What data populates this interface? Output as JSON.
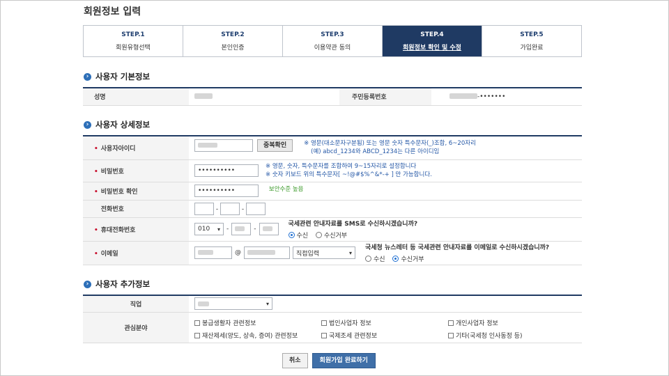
{
  "page_title": "회원정보 입력",
  "steps": [
    {
      "num": "STEP.1",
      "name": "회원유형선택"
    },
    {
      "num": "STEP.2",
      "name": "본인인증"
    },
    {
      "num": "STEP.3",
      "name": "이용약관 동의"
    },
    {
      "num": "STEP.4",
      "name": "회원정보 확인 및 수정"
    },
    {
      "num": "STEP.5",
      "name": "가입완료"
    }
  ],
  "active_step": 4,
  "basic": {
    "title": "사용자 기본정보",
    "name_label": "성명",
    "rrn_label": "주민등록번호",
    "rrn_mask": "-•••••••"
  },
  "detail": {
    "title": "사용자 상세정보",
    "id_label": "사용자아이디",
    "dup_check_button": "중복확인",
    "id_note_1": "※ 영문(대소문자구분됨) 또는 영문 숫자 특수문자(_)조합, 6~20자리",
    "id_note_2": "(예) abcd_1234와 ABCD_1234는 다른 아이디임",
    "pw_label": "비밀번호",
    "pw_value": "••••••••••",
    "pw_note_1": "※ 영문, 숫자, 특수문자를 조합하여 9~15자리로 설정합니다",
    "pw_note_2": "※ 숫자 키보드 위의 특수문자[ ~!@#$%^&*-+ ] 만 가능합니다.",
    "pw_confirm_label": "비밀번호 확인",
    "pw_confirm_value": "••••••••••",
    "pw_strength": "보안수준 높음",
    "phone_label": "전화번호",
    "dash": "-",
    "mobile_label": "휴대전화번호",
    "mobile_prefix": "010",
    "sms_question": "국세관련 안내자료를 SMS로 수신하시겠습니까?",
    "sms_options": [
      "수신",
      "수신거부"
    ],
    "sms_selected": "수신",
    "email_label": "이메일",
    "at": "@",
    "email_domain_select": "직접입력",
    "email_question": "국세청 뉴스레터 등 국세관련 안내자료를 이메일로 수신하시겠습니까?",
    "email_options": [
      "수신",
      "수신거부"
    ],
    "email_selected": "수신거부"
  },
  "extra": {
    "title": "사용자 추가정보",
    "job_label": "직업",
    "interest_label": "관심분야",
    "interests": [
      "봉급생활자 관련정보",
      "법인사업자 정보",
      "개인사업자 정보",
      "재산제세(양도, 상속, 증여) 관련정보",
      "국제조세 관련정보",
      "기타(국세청 인사동정 등)"
    ]
  },
  "buttons": {
    "cancel": "취소",
    "submit": "회원가입 완료하기"
  },
  "colors": {
    "navy": "#1f3a63",
    "accent_blue": "#2457a6",
    "required_red": "#c8102e",
    "ok_green": "#3c9a2b"
  }
}
